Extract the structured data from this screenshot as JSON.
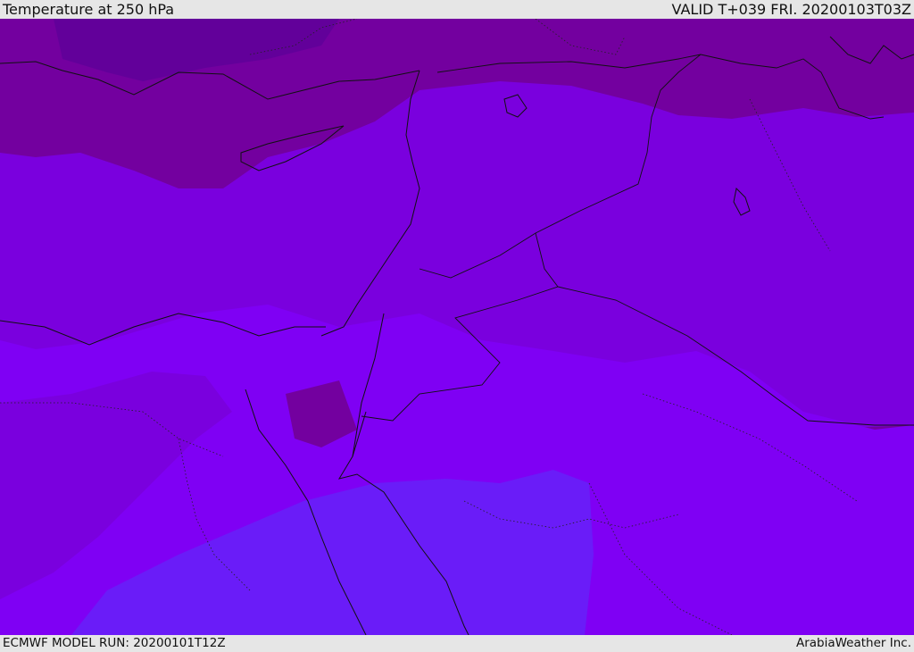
{
  "header": {
    "title": "Temperature at 250 hPa",
    "valid_time": "VALID T+039 FRI. 20200103T03Z"
  },
  "footer": {
    "model_run": "ECMWF MODEL RUN: 20200101T12Z",
    "credit": "ArabiaWeather Inc."
  },
  "map": {
    "field": "temperature",
    "level_hpa": 250,
    "region": "Eastern Mediterranean / Middle East",
    "colors": {
      "coldest": "#62009a",
      "cold": "#73009f",
      "base": "#7a00de",
      "mild": "#7f00f4",
      "warmest": "#6a1cf8",
      "coastline": "#111111"
    }
  }
}
